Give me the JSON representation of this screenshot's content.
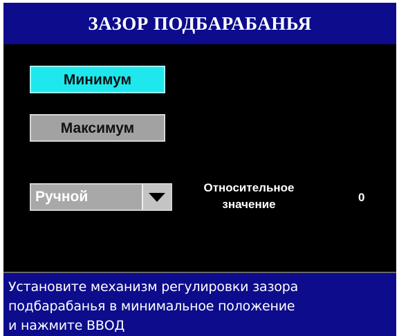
{
  "header": {
    "title": "ЗАЗОР ПОДБАРАБАНЬЯ"
  },
  "controls": {
    "min_button_label": "Минимум",
    "max_button_label": "Максимум",
    "mode_select": {
      "selected": "Ручной"
    }
  },
  "reading": {
    "label_line1": "Относительное",
    "label_line2": "значение",
    "value": "0"
  },
  "message": {
    "lines": [
      "Установите механизм регулировки зазора",
      "подбарабанья в минимальное положение",
      "и нажмите ВВОД"
    ]
  },
  "colors": {
    "title_bar": "#0c0c8c",
    "active_button": "#1ee8ee",
    "inactive_button": "#a2a2a2",
    "background": "#000000"
  }
}
